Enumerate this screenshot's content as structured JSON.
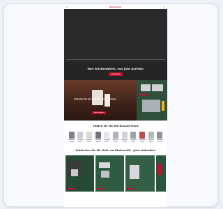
{
  "page": {
    "brand": "Kitchenaid",
    "hero": {
      "title": "Ihre Küchenideen, von Jahr perfekt!",
      "cta": "Entdecken"
    },
    "promo": {
      "text": "Entdecken Sie jetzt unsere Küchenmaschinen",
      "cta": "Mehr erfahren"
    },
    "section_products": {
      "title": "Finden Sie Ihr KitchenAid Stück"
    },
    "section_gallery": {
      "title": "Entdecken Sie die Welt von KitchenAid – jetzt einkaufen!"
    }
  },
  "colors": {
    "brand_red": "#c8102e",
    "hero_dark": "#2a2a2a",
    "gallery_green": "#2f5b42"
  }
}
